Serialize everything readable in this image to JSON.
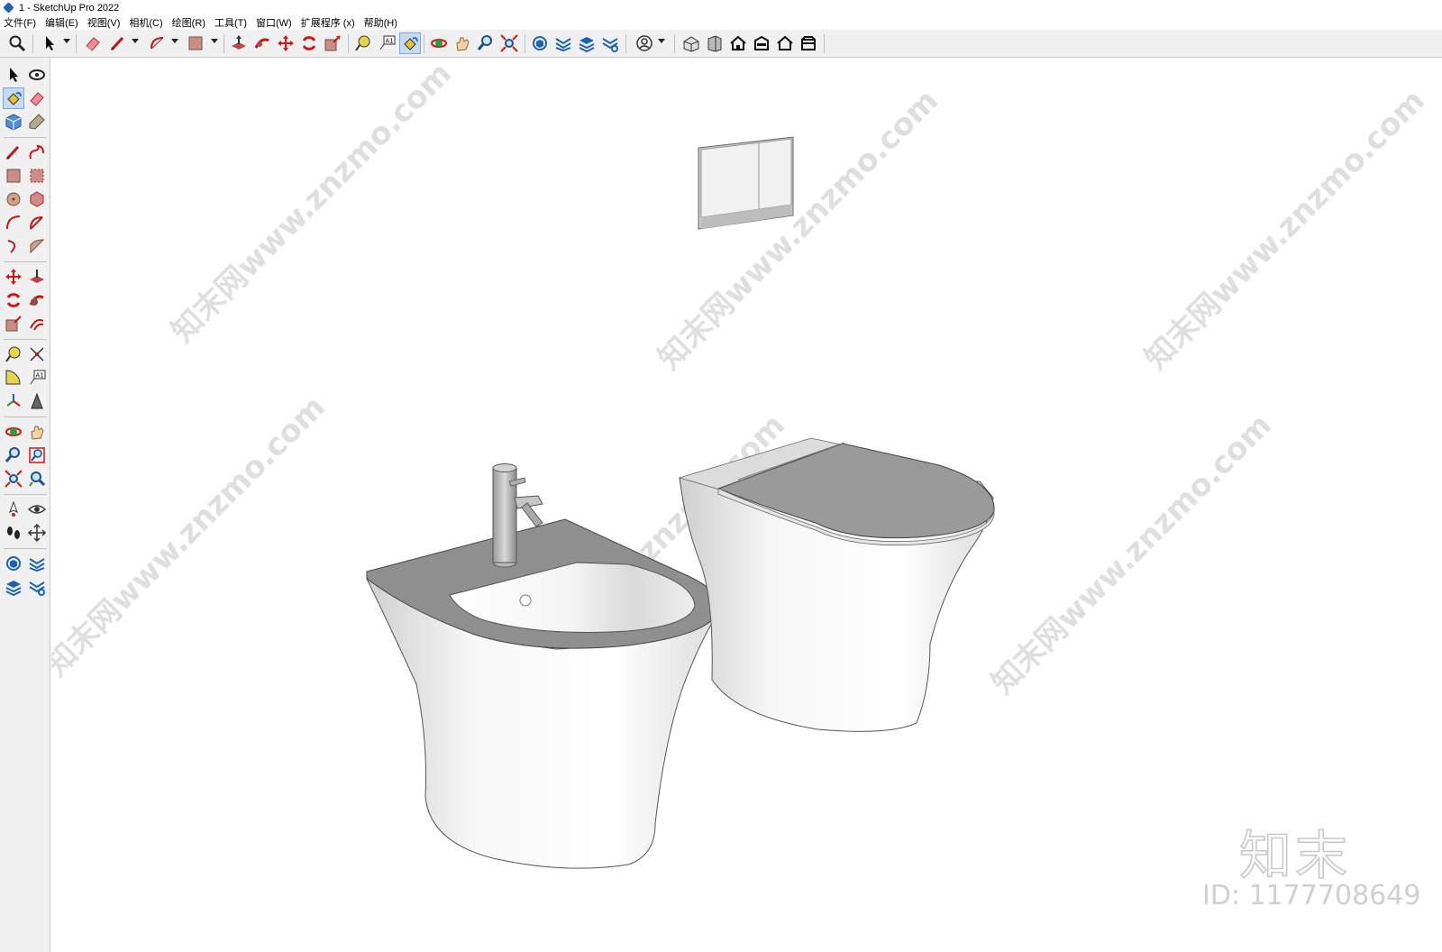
{
  "window": {
    "title": "1 - SketchUp Pro 2022"
  },
  "menu": {
    "items": [
      "文件(F)",
      "编辑(E)",
      "视图(V)",
      "相机(C)",
      "绘图(R)",
      "工具(T)",
      "窗口(W)",
      "扩展程序 (x)",
      "帮助(H)"
    ]
  },
  "toolbar": {
    "icons": [
      "zoom-icon",
      "select-icon",
      "eraser-icon",
      "pencil-icon",
      "arc-icon",
      "rectangle-icon",
      "push-pull-icon",
      "follow-me-icon",
      "move-icon",
      "rotate-icon",
      "scale-icon",
      "tape-measure-icon",
      "text-icon",
      "paint-bucket-icon",
      "orbit-icon",
      "pan-icon",
      "zoom-tool-icon",
      "zoom-extents-icon",
      "warehouse-icon",
      "extension-icon",
      "layers-icon",
      "3d-warehouse-icon",
      "account-icon",
      "iso-view-icon",
      "front-view-icon",
      "home-view-icon",
      "top-view-icon",
      "back-view-icon",
      "left-view-icon"
    ]
  },
  "sidebar": {
    "icons": [
      "select-icon",
      "orbit-icon",
      "paint-bucket-icon",
      "eraser-icon",
      "component-icon",
      "tag-icon",
      "pencil-icon",
      "freehand-icon",
      "rectangle-icon",
      "rotated-rectangle-icon",
      "circle-icon",
      "polygon-icon",
      "arc-icon",
      "pie-icon",
      "three-point-arc-icon",
      "two-point-arc-icon",
      "move-icon",
      "push-pull-icon",
      "rotate-icon",
      "follow-me-icon",
      "scale-icon",
      "offset-icon",
      "tape-measure-icon",
      "dimension-icon",
      "protractor-icon",
      "text-icon",
      "axes-icon",
      "3d-text-icon",
      "orbit-tool-icon",
      "pan-icon",
      "zoom-icon",
      "zoom-window-icon",
      "zoom-extents-icon",
      "previous-view-icon",
      "position-camera-icon",
      "look-around-icon",
      "walk-icon",
      "section-plane-icon",
      "warehouse-icon",
      "extension-warehouse-icon",
      "layout-icon",
      "sync-icon"
    ]
  },
  "watermark": {
    "brand": "知末",
    "id": "ID: 1177708649",
    "site": "知末网www.znzmo.com"
  },
  "colors": {
    "accent": "#c4dbf3",
    "model_dark": "#8f8f8f",
    "model_light": "#ffffff"
  }
}
